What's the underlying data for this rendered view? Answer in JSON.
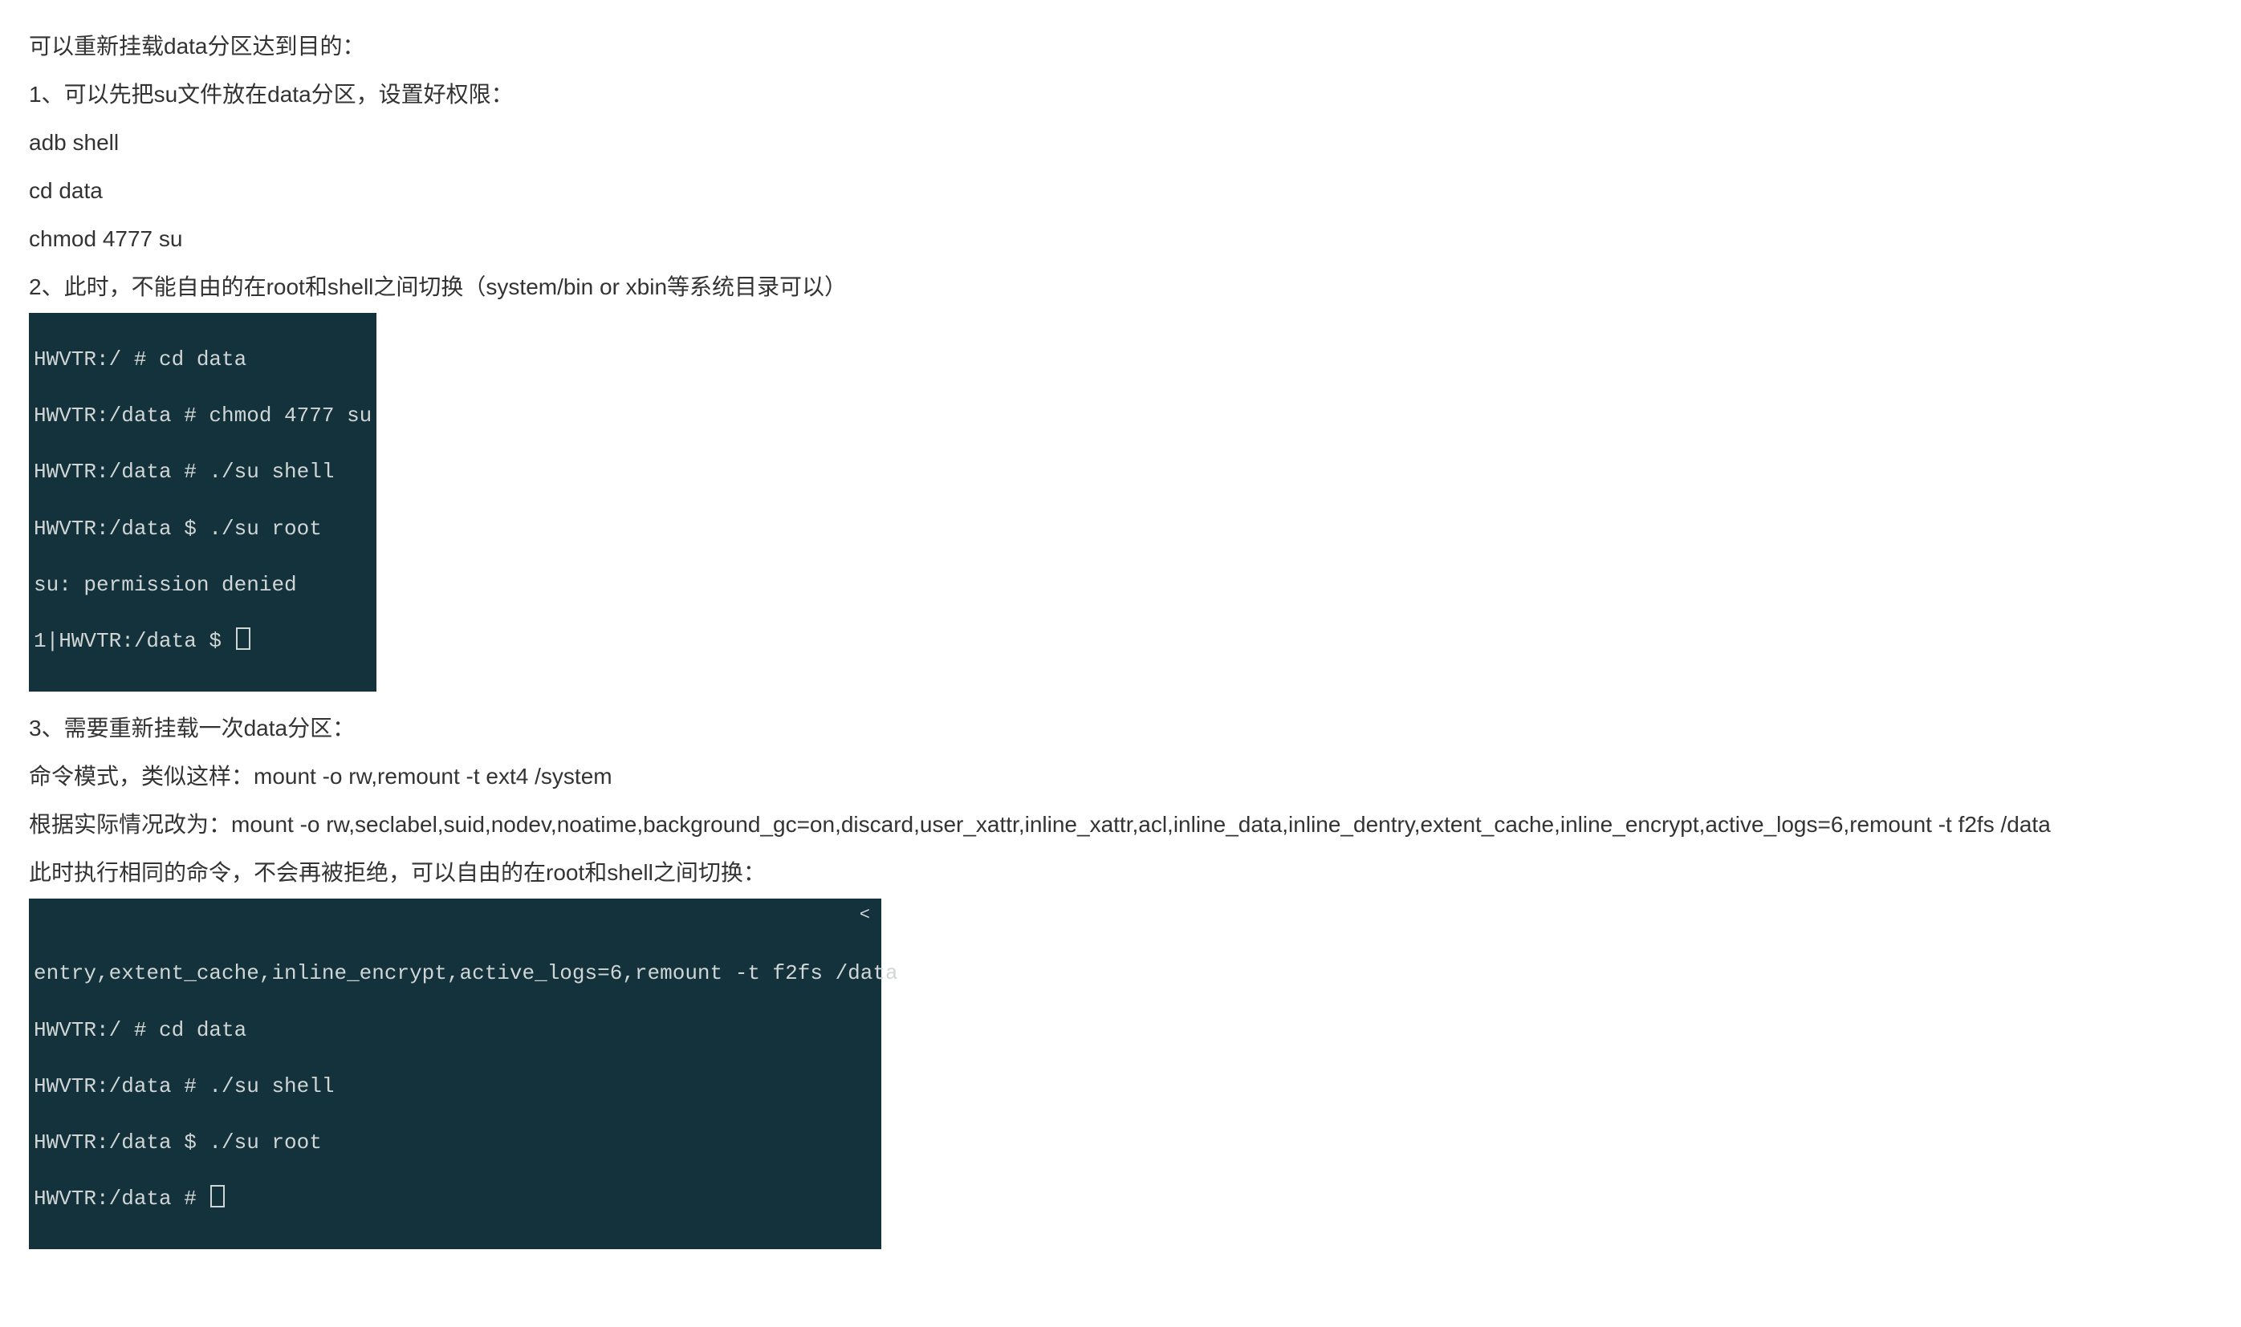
{
  "p1": "可以重新挂载data分区达到目的：",
  "p2": "1、可以先把su文件放在data分区，设置好权限：",
  "p3": "adb shell",
  "p4": "cd data",
  "p5": "chmod 4777 su",
  "p6": "2、此时，不能自由的在root和shell之间切换（system/bin or xbin等系统目录可以）",
  "t1l1": "HWVTR:/ # cd data",
  "t1l2": "HWVTR:/data # chmod 4777 su",
  "t1l3": "HWVTR:/data # ./su shell",
  "t1l4": "HWVTR:/data $ ./su root",
  "t1l5": "su: permission denied",
  "t1l6": "1|HWVTR:/data $ ",
  "p7": "3、需要重新挂载一次data分区：",
  "p8": "命令模式，类似这样：mount -o rw,remount -t ext4 /system",
  "p9": "根据实际情况改为：mount -o rw,seclabel,suid,nodev,noatime,background_gc=on,discard,user_xattr,inline_xattr,acl,inline_data,inline_dentry,extent_cache,inline_encrypt,active_logs=6,remount -t f2fs /data",
  "p10": "此时执行相同的命令，不会再被拒绝，可以自由的在root和shell之间切换：",
  "t2l1": "entry,extent_cache,inline_encrypt,active_logs=6,remount -t f2fs /data",
  "t2angle": "<",
  "t2l2": "HWVTR:/ # cd data",
  "t2l3": "HWVTR:/data # ./su shell",
  "t2l4": "HWVTR:/data $ ./su root",
  "t2l5": "HWVTR:/data # "
}
